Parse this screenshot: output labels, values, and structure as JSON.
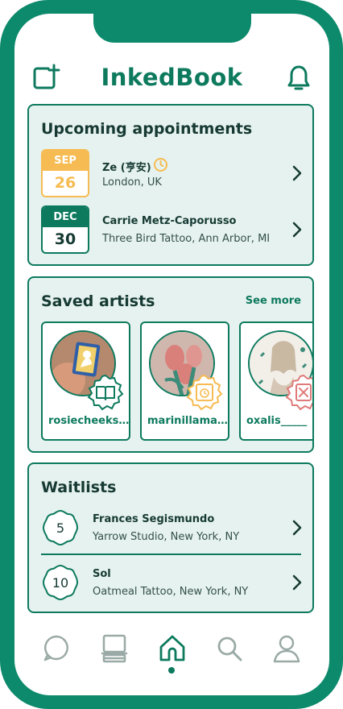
{
  "app": {
    "title": "InkedBook"
  },
  "upcoming": {
    "title": "Upcoming appointments",
    "items": [
      {
        "month": "SEP",
        "day": "26",
        "name": "Ze (亨安)",
        "location": "London, UK",
        "status": "pending",
        "accent": "#f6bb52"
      },
      {
        "month": "DEC",
        "day": "30",
        "name": "Carrie Metz-Caporusso",
        "location": "Three Bird Tattoo, Ann Arbor, MI",
        "status": "confirmed",
        "accent": "#0d7a5e"
      }
    ]
  },
  "saved": {
    "title": "Saved artists",
    "see_more": "See more",
    "artists": [
      {
        "handle": "rosiecheeks…",
        "badge": "book-icon"
      },
      {
        "handle": "marinillama…",
        "badge": "calendar-icon"
      },
      {
        "handle": "oxalis_____",
        "badge": "closed-icon"
      }
    ]
  },
  "waitlists": {
    "title": "Waitlists",
    "items": [
      {
        "position": "5",
        "name": "Frances Segismundo",
        "location": "Yarrow Studio, New York, NY"
      },
      {
        "position": "10",
        "name": "Sol",
        "location": "Oatmeal Tattoo, New York, NY"
      }
    ]
  },
  "nav": {
    "items": [
      "messages-icon",
      "bookings-icon",
      "home-icon",
      "search-icon",
      "profile-icon"
    ],
    "active": "home-icon"
  },
  "colors": {
    "brand": "#0d7a5e",
    "card_bg": "#e6f2ef",
    "pending": "#f6bb52",
    "closed": "#e07a7a",
    "nav_inactive": "#9aaaa6"
  }
}
